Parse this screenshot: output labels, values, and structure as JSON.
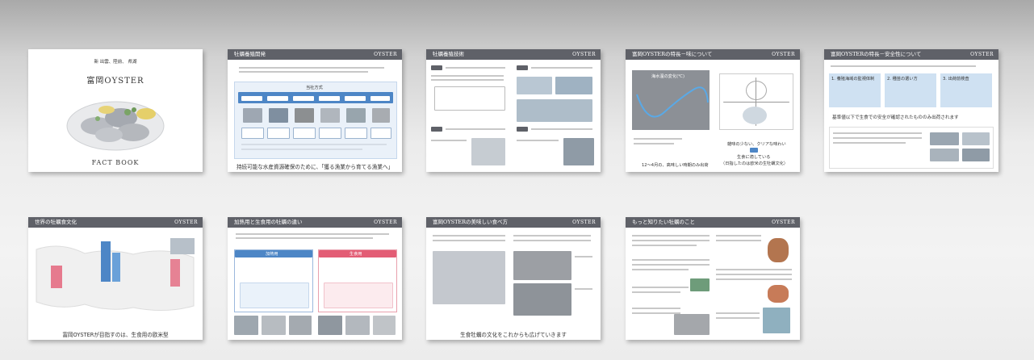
{
  "slides": [
    {
      "title": "",
      "logo": "",
      "caption": "",
      "cover_tagline": "新 出雲、陸前、 県湖",
      "cover_title": "富岡OYSTER",
      "cover_subtitle": "FACT BOOK"
    },
    {
      "title": "牡蠣養殖開発",
      "logo": "OYSTER",
      "caption": "持続可能な水産資源確保のために、「獲る漁業から育てる漁業へ」",
      "box_title": "当社方式"
    },
    {
      "title": "牡蠣養殖技術",
      "logo": "OYSTER",
      "caption": ""
    },
    {
      "title": "富岡OYSTERの特長－味について",
      "logo": "OYSTER",
      "caption": "",
      "chart_title": "海水温の変化(℃)",
      "chart_caption": "12～4月の、高味しい時期のみ出荷",
      "right_label_1": "雑味の少ない、クリアな味わい",
      "right_label_2": "生食に適している",
      "right_label_3": "（日指したのは欧米の生牡蠣文化）"
    },
    {
      "title": "富岡OYSTERの特長－安全性について",
      "logo": "OYSTER",
      "caption": "",
      "banner": "基準値以下で生食での安全が確認されたもののみ出荷されます",
      "box1": "1. 養殖海域の監視体制",
      "box2": "2. 種苗の選い方",
      "box3": "3. 出荷前検査"
    },
    {
      "title": "世界の牡蠣食文化",
      "logo": "OYSTER",
      "caption": "富岡OYSTERが目指すのは、生食用の欧米型"
    },
    {
      "title": "加熱用と生食用の牡蠣の違い",
      "logo": "OYSTER",
      "caption": "",
      "left_tab": "加熱用",
      "right_tab": "生食用"
    },
    {
      "title": "富岡OYSTERの美味しい食べ方",
      "logo": "OYSTER",
      "caption": "生食牡蠣の文化をこれからも広げていきます"
    },
    {
      "title": "もっと知りたい牡蠣のこと",
      "logo": "OYSTER",
      "caption": ""
    }
  ],
  "colors": {
    "header": "#5f6168",
    "blue": "#4d86c6",
    "pink": "#e35d75",
    "light_blue": "#cfe1f2"
  }
}
